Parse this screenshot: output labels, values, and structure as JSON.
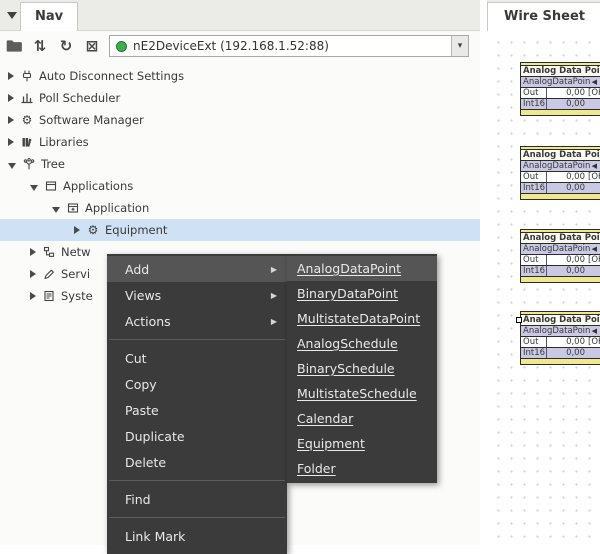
{
  "colors": {
    "selection": "#cfe1f5",
    "menu_bg": "#3b3b3b",
    "menu_highlight": "#555555",
    "status_green": "#3fae49",
    "block_lavender": "#c9c9e4",
    "block_yellow": "#efe88d"
  },
  "glyphs": {
    "reorder": "⇅",
    "refresh": "↻",
    "clear": "⊠",
    "gear": "⚙",
    "combo_arrow": "▾",
    "submenu_arrow": "▶",
    "block_chevron": "◀"
  },
  "nav_panel": {
    "tab_label": "Nav",
    "device_combo_value": "nE2DeviceExt (192.168.1.52:88)",
    "tree": {
      "items": [
        {
          "label": "Auto Disconnect Settings"
        },
        {
          "label": "Poll Scheduler"
        },
        {
          "label": "Software Manager"
        },
        {
          "label": "Libraries"
        },
        {
          "label": "Tree"
        },
        {
          "label": "Applications"
        },
        {
          "label": "Application"
        },
        {
          "label": "Equipment",
          "selected": true
        },
        {
          "label": "Netw"
        },
        {
          "label": "Servi"
        },
        {
          "label": "Syste"
        }
      ]
    }
  },
  "context_menu": {
    "items": [
      {
        "label": "Add",
        "has_submenu": true,
        "highlighted": true
      },
      {
        "label": "Views",
        "has_submenu": true
      },
      {
        "label": "Actions",
        "has_submenu": true
      },
      {
        "label": "Cut"
      },
      {
        "label": "Copy"
      },
      {
        "label": "Paste"
      },
      {
        "label": "Duplicate"
      },
      {
        "label": "Delete"
      },
      {
        "label": "Find"
      },
      {
        "label": "Link Mark"
      }
    ]
  },
  "add_submenu": {
    "items": [
      {
        "label": "AnalogDataPoint",
        "highlighted": true
      },
      {
        "label": "BinaryDataPoint"
      },
      {
        "label": "MultistateDataPoint"
      },
      {
        "label": "AnalogSchedule"
      },
      {
        "label": "BinarySchedule"
      },
      {
        "label": "MultistateSchedule"
      },
      {
        "label": "Calendar"
      },
      {
        "label": "Equipment"
      },
      {
        "label": "Folder"
      }
    ]
  },
  "wire_sheet": {
    "tab_label": "Wire Sheet",
    "blocks": [
      {
        "title": "Analog Data Poi",
        "type": "AnalogDataPoin",
        "rows": [
          {
            "name": "Out",
            "value": "0,00",
            "status": "[OK]"
          },
          {
            "name": "Int16",
            "value": "0,00"
          }
        ]
      },
      {
        "title": "Analog Data Poi",
        "type": "AnalogDataPoin",
        "rows": [
          {
            "name": "Out",
            "value": "0,00",
            "status": "[OK]"
          },
          {
            "name": "Int16",
            "value": "0,00"
          }
        ]
      },
      {
        "title": "Analog Data Poi",
        "type": "AnalogDataPoin",
        "rows": [
          {
            "name": "Out",
            "value": "0,00",
            "status": "[OK]"
          },
          {
            "name": "Int16",
            "value": "0,00"
          }
        ]
      },
      {
        "title": "Analog Data Poi",
        "type": "AnalogDataPoin",
        "rows": [
          {
            "name": "Out",
            "value": "0,00",
            "status": "[OK]"
          },
          {
            "name": "Int16",
            "value": "0,00"
          }
        ]
      }
    ]
  }
}
